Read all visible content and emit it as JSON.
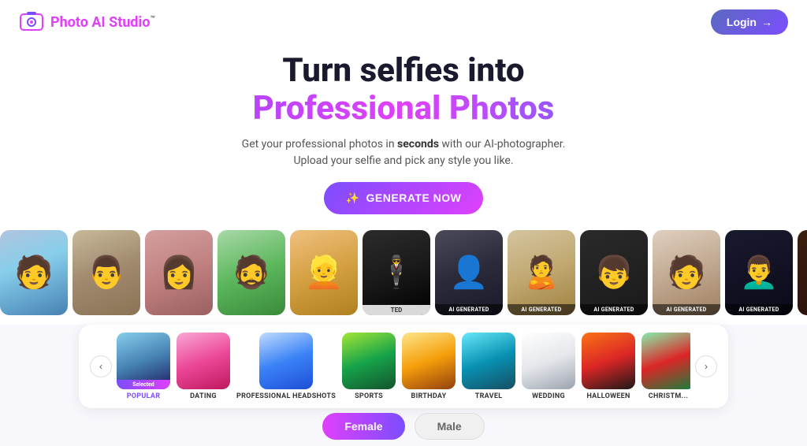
{
  "header": {
    "logo_text": "Photo AI Studio",
    "logo_tm": "™",
    "login_label": "Login",
    "login_arrow": "→"
  },
  "hero": {
    "title_line1": "Turn selfies into",
    "title_line2": "Professional Photos",
    "subtitle_line1": "Get your professional photos in ",
    "subtitle_bold": "seconds",
    "subtitle_line2": " with our AI-photographer.",
    "subtitle_line3": "Upload your selfie and pick any style you like.",
    "generate_label": "GENERATE NOW"
  },
  "photo_strip": {
    "cards": [
      {
        "id": "p1",
        "color_class": "pc-1",
        "type": "normal"
      },
      {
        "id": "p2",
        "color_class": "pc-2",
        "type": "normal"
      },
      {
        "id": "p3",
        "color_class": "pc-3",
        "type": "normal"
      },
      {
        "id": "p4",
        "color_class": "pc-4",
        "type": "normal"
      },
      {
        "id": "p5",
        "color_class": "pc-5",
        "type": "normal"
      },
      {
        "id": "p6",
        "color_class": "pc-6",
        "type": "ted"
      },
      {
        "id": "p7",
        "color_class": "pc-7",
        "type": "ai"
      },
      {
        "id": "p8",
        "color_class": "pc-8",
        "type": "ai"
      },
      {
        "id": "p9",
        "color_class": "pc-9",
        "type": "ai"
      },
      {
        "id": "p10",
        "color_class": "pc-10",
        "type": "ai"
      },
      {
        "id": "p11",
        "color_class": "pc-11",
        "type": "ai"
      },
      {
        "id": "p12",
        "color_class": "pc-12",
        "type": "ai_partial"
      }
    ]
  },
  "categories": {
    "prev_label": "‹",
    "next_label": "›",
    "items": [
      {
        "id": "popular",
        "label": "POPULAR",
        "color_class": "ct-popular",
        "selected": true
      },
      {
        "id": "dating",
        "label": "DATING",
        "color_class": "ct-dating",
        "selected": false
      },
      {
        "id": "headshots",
        "label": "PROFESSIONAL HEADSHOTS",
        "color_class": "ct-headshots",
        "selected": false
      },
      {
        "id": "sports",
        "label": "SPORTS",
        "color_class": "ct-sports",
        "selected": false
      },
      {
        "id": "birthday",
        "label": "BIRTHDAY",
        "color_class": "ct-birthday",
        "selected": false
      },
      {
        "id": "travel",
        "label": "TRAVEL",
        "color_class": "ct-travel",
        "selected": false
      },
      {
        "id": "wedding",
        "label": "WEDDING",
        "color_class": "ct-wedding",
        "selected": false
      },
      {
        "id": "halloween",
        "label": "HALLOWEEN",
        "color_class": "ct-halloween",
        "selected": false
      },
      {
        "id": "christmas",
        "label": "CHRISTM...",
        "color_class": "ct-christmas",
        "selected": false
      }
    ],
    "selected_badge_label": "Selected"
  },
  "gender": {
    "female_label": "Female",
    "male_label": "Male"
  }
}
